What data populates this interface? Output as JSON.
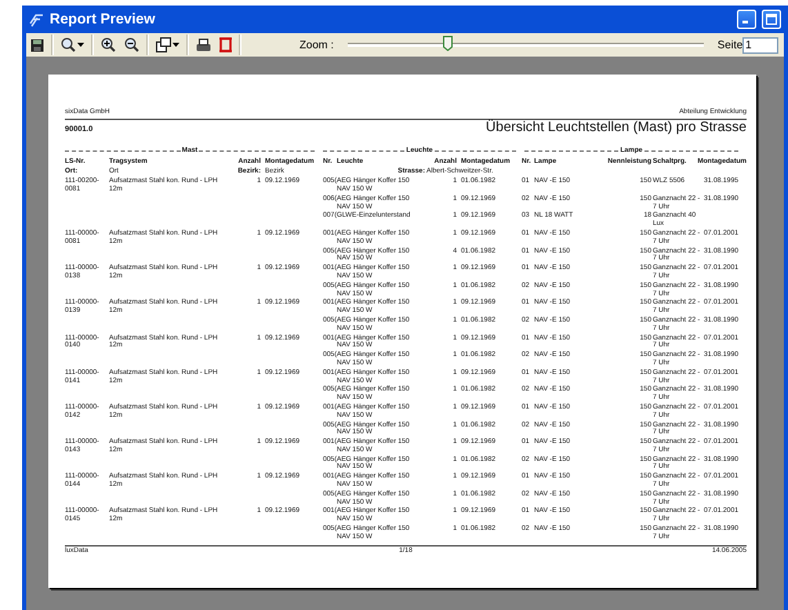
{
  "window": {
    "title": "Report Preview"
  },
  "toolbar": {
    "zoom_label": "Zoom :",
    "zoom": {
      "level": 0.28
    },
    "page_label": "Seite",
    "page": "1"
  },
  "report": {
    "company": "sixData GmbH",
    "department": "Abteilung Entwicklung",
    "number": "90001.0",
    "title": "Übersicht Leuchtstellen (Mast) pro Strasse",
    "sections": [
      "Mast",
      "Leuchte",
      "Lampe"
    ],
    "columns": [
      "LS-Nr.",
      "Tragsystem",
      "Anzahl",
      "Montagedatum",
      "Nr.",
      "Leuchte",
      "Anzahl",
      "Montagedatum",
      "Nr.",
      "Lampe",
      "Nennleistung",
      "Schaltprg.",
      "Montagedatum"
    ],
    "filters": [
      {
        "label": "Ort:",
        "value": "Ort"
      },
      {
        "label": "Bezirk:",
        "value": "Bezirk"
      },
      {
        "label": "Strasse:",
        "value": "Albert-Schweitzer-Str."
      }
    ],
    "masts": [
      {
        "ls_nr": "111-00200-0081",
        "tragsystem": "Aufsatzmast Stahl kon. Rund - LPH 12m",
        "anzahl": "1",
        "montagedatum": "09.12.1969",
        "leuchten": [
          {
            "nr": "005(",
            "leuchte": "AEG Hänger Koffer 150 NAV 150 W",
            "anzahl": "1",
            "montagedatum": "01.06.1982",
            "lampe_nr": "01",
            "lampe": "NAV -E 150",
            "nennleistung": "150",
            "schaltprogramm": "WLZ 5506",
            "lampe_montagedatum": "31.08.1995"
          },
          {
            "nr": "006(",
            "leuchte": "AEG Hänger Koffer 150 NAV 150 W",
            "anzahl": "1",
            "montagedatum": "09.12.1969",
            "lampe_nr": "02",
            "lampe": "NAV -E 150",
            "nennleistung": "150",
            "schaltprogramm": "Ganznacht 22 - 7 Uhr",
            "lampe_montagedatum": "31.08.1990"
          },
          {
            "nr": "007(",
            "leuchte": "GLWE-Einzelunterstand",
            "anzahl": "1",
            "montagedatum": "09.12.1969",
            "lampe_nr": "03",
            "lampe": "NL 18 WATT",
            "nennleistung": "18",
            "schaltprogramm": "Ganznacht 40 Lux"
          }
        ]
      },
      {
        "ls_nr": "111-00000-0081",
        "tragsystem": "Aufsatzmast Stahl kon. Rund - LPH 12m",
        "anzahl": "1",
        "montagedatum": "09.12.1969",
        "leuchten": [
          {
            "nr": "001(",
            "leuchte": "AEG Hänger Koffer 150 NAV 150 W",
            "anzahl": "1",
            "montagedatum": "09.12.1969",
            "lampe_nr": "01",
            "lampe": "NAV -E 150",
            "nennleistung": "150",
            "schaltprogramm": "Ganznacht 22 - 7 Uhr",
            "lampe_montagedatum": "07.01.2001"
          },
          {
            "nr": "005(",
            "leuchte": "AEG Hänger Koffer 150 NAV 150 W",
            "anzahl": "4",
            "montagedatum": "01.06.1982",
            "lampe_nr": "01",
            "lampe": "NAV -E 150",
            "nennleistung": "150",
            "schaltprogramm": "Ganznacht 22 - 7 Uhr",
            "lampe_montagedatum": "31.08.1990"
          }
        ]
      },
      {
        "ls_nr": "111-00000-0138",
        "tragsystem": "Aufsatzmast Stahl kon. Rund - LPH 12m",
        "anzahl": "1",
        "montagedatum": "09.12.1969",
        "leuchten": [
          {
            "nr": "001(",
            "leuchte": "AEG Hänger Koffer 150 NAV 150 W",
            "anzahl": "1",
            "montagedatum": "09.12.1969",
            "lampe_nr": "01",
            "lampe": "NAV -E 150",
            "nennleistung": "150",
            "schaltprogramm": "Ganznacht 22 - 7 Uhr",
            "lampe_montagedatum": "07.01.2001"
          },
          {
            "nr": "005(",
            "leuchte": "AEG Hänger Koffer 150 NAV 150 W",
            "anzahl": "1",
            "montagedatum": "01.06.1982",
            "lampe_nr": "02",
            "lampe": "NAV -E 150",
            "nennleistung": "150",
            "schaltprogramm": "Ganznacht 22 - 7 Uhr",
            "lampe_montagedatum": "31.08.1990"
          }
        ]
      },
      {
        "ls_nr": "111-00000-0139",
        "tragsystem": "Aufsatzmast Stahl kon. Rund - LPH 12m",
        "anzahl": "1",
        "montagedatum": "09.12.1969",
        "leuchten": [
          {
            "nr": "001(",
            "leuchte": "AEG Hänger Koffer 150 NAV 150 W",
            "anzahl": "1",
            "montagedatum": "09.12.1969",
            "lampe_nr": "01",
            "lampe": "NAV -E 150",
            "nennleistung": "150",
            "schaltprogramm": "Ganznacht 22 - 7 Uhr",
            "lampe_montagedatum": "07.01.2001"
          },
          {
            "nr": "005(",
            "leuchte": "AEG Hänger Koffer 150 NAV 150 W",
            "anzahl": "1",
            "montagedatum": "01.06.1982",
            "lampe_nr": "02",
            "lampe": "NAV -E 150",
            "nennleistung": "150",
            "schaltprogramm": "Ganznacht 22 - 7 Uhr",
            "lampe_montagedatum": "31.08.1990"
          }
        ]
      },
      {
        "ls_nr": "111-00000-0140",
        "tragsystem": "Aufsatzmast Stahl kon. Rund - LPH 12m",
        "anzahl": "1",
        "montagedatum": "09.12.1969",
        "leuchten": [
          {
            "nr": "001(",
            "leuchte": "AEG Hänger Koffer 150 NAV 150 W",
            "anzahl": "1",
            "montagedatum": "09.12.1969",
            "lampe_nr": "01",
            "lampe": "NAV -E 150",
            "nennleistung": "150",
            "schaltprogramm": "Ganznacht 22 - 7 Uhr",
            "lampe_montagedatum": "07.01.2001"
          },
          {
            "nr": "005(",
            "leuchte": "AEG Hänger Koffer 150 NAV 150 W",
            "anzahl": "1",
            "montagedatum": "01.06.1982",
            "lampe_nr": "02",
            "lampe": "NAV -E 150",
            "nennleistung": "150",
            "schaltprogramm": "Ganznacht 22 - 7 Uhr",
            "lampe_montagedatum": "31.08.1990"
          }
        ]
      },
      {
        "ls_nr": "111-00000-0141",
        "tragsystem": "Aufsatzmast Stahl kon. Rund - LPH 12m",
        "anzahl": "1",
        "montagedatum": "09.12.1969",
        "leuchten": [
          {
            "nr": "001(",
            "leuchte": "AEG Hänger Koffer 150 NAV 150 W",
            "anzahl": "1",
            "montagedatum": "09.12.1969",
            "lampe_nr": "01",
            "lampe": "NAV -E 150",
            "nennleistung": "150",
            "schaltprogramm": "Ganznacht 22 - 7 Uhr",
            "lampe_montagedatum": "07.01.2001"
          },
          {
            "nr": "005(",
            "leuchte": "AEG Hänger Koffer 150 NAV 150 W",
            "anzahl": "1",
            "montagedatum": "01.06.1982",
            "lampe_nr": "02",
            "lampe": "NAV -E 150",
            "nennleistung": "150",
            "schaltprogramm": "Ganznacht 22 - 7 Uhr",
            "lampe_montagedatum": "31.08.1990"
          }
        ]
      },
      {
        "ls_nr": "111-00000-0142",
        "tragsystem": "Aufsatzmast Stahl kon. Rund - LPH 12m",
        "anzahl": "1",
        "montagedatum": "09.12.1969",
        "leuchten": [
          {
            "nr": "001(",
            "leuchte": "AEG Hänger Koffer 150 NAV 150 W",
            "anzahl": "1",
            "montagedatum": "09.12.1969",
            "lampe_nr": "01",
            "lampe": "NAV -E 150",
            "nennleistung": "150",
            "schaltprogramm": "Ganznacht 22 - 7 Uhr",
            "lampe_montagedatum": "07.01.2001"
          },
          {
            "nr": "005(",
            "leuchte": "AEG Hänger Koffer 150 NAV 150 W",
            "anzahl": "1",
            "montagedatum": "01.06.1982",
            "lampe_nr": "02",
            "lampe": "NAV -E 150",
            "nennleistung": "150",
            "schaltprogramm": "Ganznacht 22 - 7 Uhr",
            "lampe_montagedatum": "31.08.1990"
          }
        ]
      },
      {
        "ls_nr": "111-00000-0143",
        "tragsystem": "Aufsatzmast Stahl kon. Rund - LPH 12m",
        "anzahl": "1",
        "montagedatum": "09.12.1969",
        "leuchten": [
          {
            "nr": "001(",
            "leuchte": "AEG Hänger Koffer 150 NAV 150 W",
            "anzahl": "1",
            "montagedatum": "09.12.1969",
            "lampe_nr": "01",
            "lampe": "NAV -E 150",
            "nennleistung": "150",
            "schaltprogramm": "Ganznacht 22 - 7 Uhr",
            "lampe_montagedatum": "07.01.2001"
          },
          {
            "nr": "005(",
            "leuchte": "AEG Hänger Koffer 150 NAV 150 W",
            "anzahl": "1",
            "montagedatum": "01.06.1982",
            "lampe_nr": "02",
            "lampe": "NAV -E 150",
            "nennleistung": "150",
            "schaltprogramm": "Ganznacht 22 - 7 Uhr",
            "lampe_montagedatum": "31.08.1990"
          }
        ]
      },
      {
        "ls_nr": "111-00000-0144",
        "tragsystem": "Aufsatzmast Stahl kon. Rund - LPH 12m",
        "anzahl": "1",
        "montagedatum": "09.12.1969",
        "leuchten": [
          {
            "nr": "001(",
            "leuchte": "AEG Hänger Koffer 150 NAV 150 W",
            "anzahl": "1",
            "montagedatum": "09.12.1969",
            "lampe_nr": "01",
            "lampe": "NAV -E 150",
            "nennleistung": "150",
            "schaltprogramm": "Ganznacht 22 - 7 Uhr",
            "lampe_montagedatum": "07.01.2001"
          },
          {
            "nr": "005(",
            "leuchte": "AEG Hänger Koffer 150 NAV 150 W",
            "anzahl": "1",
            "montagedatum": "01.06.1982",
            "lampe_nr": "02",
            "lampe": "NAV -E 150",
            "nennleistung": "150",
            "schaltprogramm": "Ganznacht 22 - 7 Uhr",
            "lampe_montagedatum": "31.08.1990"
          }
        ]
      },
      {
        "ls_nr": "111-00000-0145",
        "tragsystem": "Aufsatzmast Stahl kon. Rund - LPH 12m",
        "anzahl": "1",
        "montagedatum": "09.12.1969",
        "leuchten": [
          {
            "nr": "001(",
            "leuchte": "AEG Hänger Koffer 150 NAV 150 W",
            "anzahl": "1",
            "montagedatum": "09.12.1969",
            "lampe_nr": "01",
            "lampe": "NAV -E 150",
            "nennleistung": "150",
            "schaltprogramm": "Ganznacht 22 - 7 Uhr",
            "lampe_montagedatum": "07.01.2001"
          },
          {
            "nr": "005(",
            "leuchte": "AEG Hänger Koffer 150 NAV 150 W",
            "anzahl": "1",
            "montagedatum": "01.06.1982",
            "lampe_nr": "02",
            "lampe": "NAV -E 150",
            "nennleistung": "150",
            "schaltprogramm": "Ganznacht 22 - 7 Uhr",
            "lampe_montagedatum": "31.08.1990"
          }
        ]
      }
    ],
    "footer": {
      "left": "luxData",
      "page": "1/18",
      "date": "14.06.2005"
    }
  }
}
